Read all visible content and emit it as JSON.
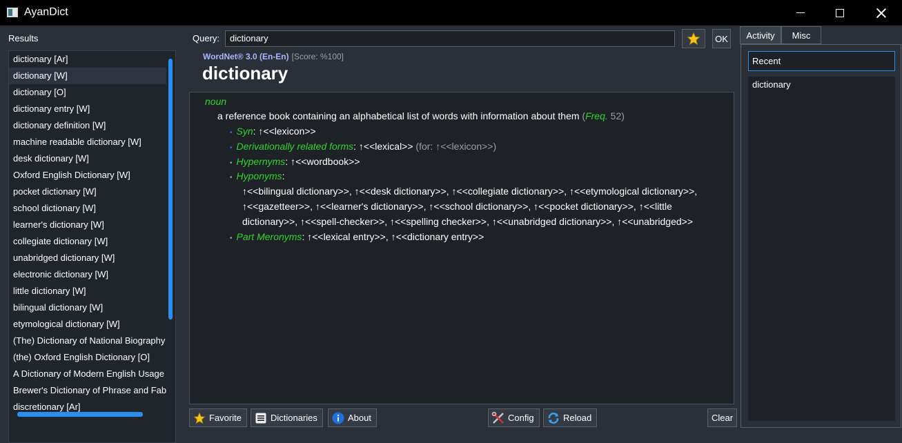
{
  "window": {
    "title": "AyanDict",
    "icon": "app-icon"
  },
  "results": {
    "label": "Results",
    "items": [
      "dictionary [Ar]",
      "dictionary [W]",
      "dictionary [O]",
      "dictionary entry [W]",
      "dictionary definition [W]",
      "machine readable dictionary [W]",
      "desk dictionary [W]",
      "Oxford English Dictionary [W]",
      "pocket dictionary [W]",
      "school dictionary [W]",
      "learner's dictionary [W]",
      "collegiate dictionary [W]",
      "unabridged dictionary [W]",
      "electronic dictionary [W]",
      "little dictionary [W]",
      "bilingual dictionary [W]",
      "etymological dictionary [W]",
      "(The) Dictionary of National Biography [",
      "(the) Oxford English Dictionary [O]",
      "A Dictionary of Modern English Usage [",
      "Brewer's Dictionary of Phrase and Fable",
      "discretionary [Ar]"
    ],
    "selected_index": 1
  },
  "query": {
    "label": "Query:",
    "value": "dictionary",
    "favorite_icon": "star-icon",
    "ok_label": "OK"
  },
  "entry": {
    "source": "WordNet® 3.0 (En-En)",
    "score": "[Score: %100]",
    "headword": "dictionary",
    "pos": "noun",
    "gloss": "a reference book containing an alphabetical list of words with information about them",
    "freq_open": "(",
    "freq_label": "Freq.",
    "freq_value": "52)",
    "relations": {
      "syn": {
        "name": "Syn",
        "value": ": ↑<<lexicon>>"
      },
      "deriv": {
        "name": "Derivationally related forms",
        "value": ": ↑<<lexical>>",
        "extra": " (for: ↑<<lexicon>>)"
      },
      "hypernyms": {
        "name": "Hypernyms",
        "value": ": ↑<<wordbook>>"
      },
      "hyponyms": {
        "name": "Hyponyms",
        "value": ":",
        "lines": [
          "↑<<bilingual dictionary>>, ↑<<desk dictionary>>, ↑<<collegiate dictionary>>, ↑<<etymological dictionary>>,",
          "↑<<gazetteer>>, ↑<<learner's dictionary>>, ↑<<school dictionary>>, ↑<<pocket dictionary>>, ↑<<little",
          "dictionary>>, ↑<<spell-checker>>, ↑<<spelling checker>>, ↑<<unabridged dictionary>>, ↑<<unabridged>>"
        ]
      },
      "meronyms": {
        "name": "Part Meronyms",
        "value": ": ↑<<lexical entry>>, ↑<<dictionary entry>>"
      }
    }
  },
  "toolbar": {
    "favorite": {
      "label": "Favorite",
      "icon": "star-icon"
    },
    "dictionaries": {
      "label": "Dictionaries",
      "icon": "list-icon"
    },
    "about": {
      "label": "About",
      "icon": "info-icon"
    },
    "config": {
      "label": "Config",
      "icon": "tools-icon"
    },
    "reload": {
      "label": "Reload",
      "icon": "reload-icon"
    },
    "clear": {
      "label": "Clear"
    }
  },
  "sidepanel": {
    "tabs": [
      "Activity",
      "Misc"
    ],
    "active_tab": "Activity",
    "recent_label": "Recent",
    "recent_items": [
      "dictionary"
    ]
  },
  "colors": {
    "accent": "#2a8ef0",
    "relation_green": "#2fd52f",
    "source_blue": "#a7b6ff",
    "background": "#2b3038"
  }
}
